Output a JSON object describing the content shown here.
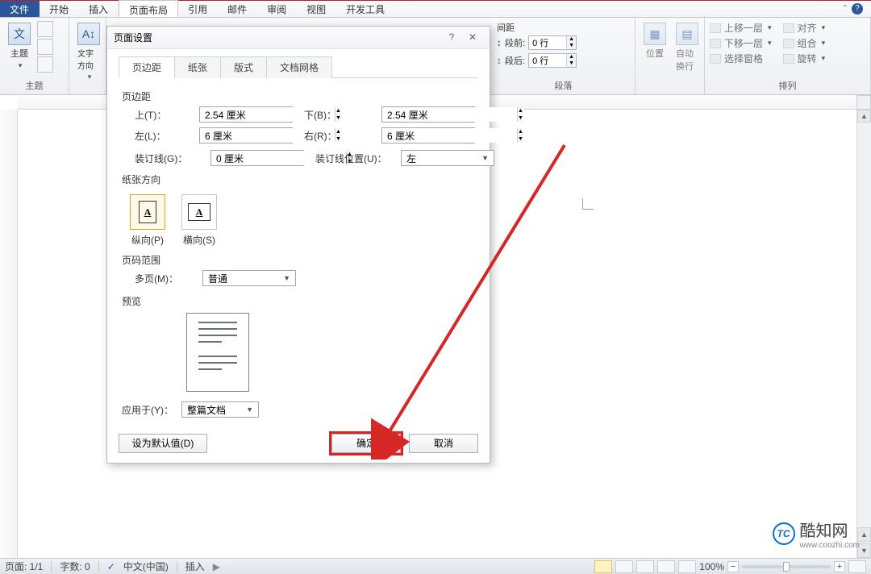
{
  "menu": {
    "file": "文件",
    "home": "开始",
    "insert": "插入",
    "layout": "页面布局",
    "references": "引用",
    "mail": "邮件",
    "review": "审阅",
    "view": "视图",
    "dev": "开发工具"
  },
  "ribbon": {
    "g1": {
      "label": "主题",
      "main": "主题"
    },
    "g2": {
      "label": "",
      "main": "文字方向"
    },
    "g3": {
      "label": "段落",
      "title": "间距",
      "before_lbl": "段前:",
      "after_lbl": "段后:",
      "before_val": "0 行",
      "after_val": "0 行"
    },
    "g4": {
      "label": "",
      "pos": "位置",
      "wrap": "自动换行"
    },
    "g5": {
      "label": "排列",
      "up": "上移一层",
      "down": "下移一层",
      "pane": "选择窗格",
      "align": "对齐",
      "group": "组合",
      "rotate": "旋转"
    }
  },
  "dialog": {
    "title": "页面设置",
    "tabs": {
      "margins": "页边距",
      "paper": "纸张",
      "layout": "版式",
      "grid": "文档网格"
    },
    "section_margins": "页边距",
    "top_lbl": "上(T)：",
    "top_val": "2.54 厘米",
    "bottom_lbl": "下(B)：",
    "bottom_val": "2.54 厘米",
    "left_lbl": "左(L)：",
    "left_val": "6 厘米",
    "right_lbl": "右(R)：",
    "right_val": "6 厘米",
    "gutter_lbl": "装订线(G)：",
    "gutter_val": "0 厘米",
    "gutter_pos_lbl": "装订线位置(U)：",
    "gutter_pos_val": "左",
    "section_orient": "纸张方向",
    "portrait": "纵向(P)",
    "landscape": "横向(S)",
    "section_pages": "页码范围",
    "multi_lbl": "多页(M)：",
    "multi_val": "普通",
    "section_preview": "预览",
    "apply_lbl": "应用于(Y)：",
    "apply_val": "整篇文档",
    "default_btn": "设为默认值(D)",
    "ok": "确定",
    "cancel": "取消"
  },
  "statusbar": {
    "page": "页面: 1/1",
    "words": "字数: 0",
    "lang": "中文(中国)",
    "mode": "插入",
    "zoom": "100%"
  },
  "watermark": {
    "name": "酷知网",
    "url": "www.coozhi.com",
    "logo": "TC"
  }
}
